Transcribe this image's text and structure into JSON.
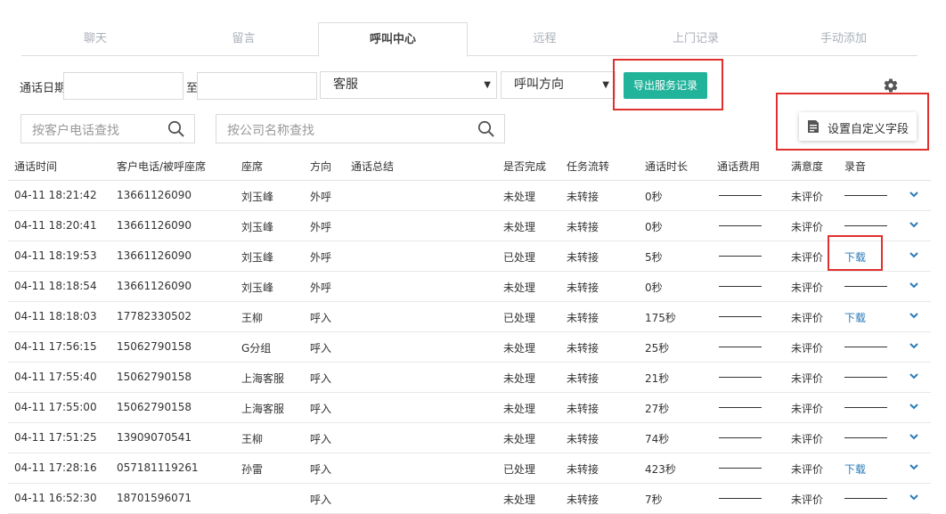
{
  "tabs": [
    {
      "label": "聊天"
    },
    {
      "label": "留言"
    },
    {
      "label": "呼叫中心",
      "active": true
    },
    {
      "label": "远程"
    },
    {
      "label": "上门记录"
    },
    {
      "label": "手动添加"
    }
  ],
  "filters": {
    "date_label": "通话日期",
    "to_label": "至",
    "agent_select": "客服",
    "direction_select": "呼叫方向",
    "export_label": "导出服务记录",
    "custom_field_label": "设置自定义字段",
    "customer_phone_placeholder": "按客户电话查找",
    "company_name_placeholder": "按公司名称查找"
  },
  "table": {
    "headers": [
      "通话时间",
      "客户电话/被呼座席",
      "座席",
      "方向",
      "通话总结",
      "是否完成",
      "任务流转",
      "通话时长",
      "通话费用",
      "满意度",
      "录音"
    ],
    "rows": [
      {
        "time": "04-11 18:21:42",
        "phone": "13661126090",
        "agent": "刘玉峰",
        "direction": "外呼",
        "summary": "",
        "done": "未处理",
        "transfer": "未转接",
        "duration": "0秒",
        "rating": "未评价",
        "recording": ""
      },
      {
        "time": "04-11 18:20:41",
        "phone": "13661126090",
        "agent": "刘玉峰",
        "direction": "外呼",
        "summary": "",
        "done": "未处理",
        "transfer": "未转接",
        "duration": "0秒",
        "rating": "未评价",
        "recording": ""
      },
      {
        "time": "04-11 18:19:53",
        "phone": "13661126090",
        "agent": "刘玉峰",
        "direction": "外呼",
        "summary": "",
        "done": "已处理",
        "transfer": "未转接",
        "duration": "5秒",
        "rating": "未评价",
        "recording": "下载"
      },
      {
        "time": "04-11 18:18:54",
        "phone": "13661126090",
        "agent": "刘玉峰",
        "direction": "外呼",
        "summary": "",
        "done": "未处理",
        "transfer": "未转接",
        "duration": "0秒",
        "rating": "未评价",
        "recording": ""
      },
      {
        "time": "04-11 18:18:03",
        "phone": "17782330502",
        "agent": "王柳",
        "direction": "呼入",
        "summary": "",
        "done": "已处理",
        "transfer": "未转接",
        "duration": "175秒",
        "rating": "未评价",
        "recording": "下载"
      },
      {
        "time": "04-11 17:56:15",
        "phone": "15062790158",
        "agent": "G分组",
        "direction": "呼入",
        "summary": "",
        "done": "未处理",
        "transfer": "未转接",
        "duration": "25秒",
        "rating": "未评价",
        "recording": ""
      },
      {
        "time": "04-11 17:55:40",
        "phone": "15062790158",
        "agent": "上海客服",
        "direction": "呼入",
        "summary": "",
        "done": "未处理",
        "transfer": "未转接",
        "duration": "21秒",
        "rating": "未评价",
        "recording": ""
      },
      {
        "time": "04-11 17:55:00",
        "phone": "15062790158",
        "agent": "上海客服",
        "direction": "呼入",
        "summary": "",
        "done": "未处理",
        "transfer": "未转接",
        "duration": "27秒",
        "rating": "未评价",
        "recording": ""
      },
      {
        "time": "04-11 17:51:25",
        "phone": "13909070541",
        "agent": "王柳",
        "direction": "呼入",
        "summary": "",
        "done": "未处理",
        "transfer": "未转接",
        "duration": "74秒",
        "rating": "未评价",
        "recording": ""
      },
      {
        "time": "04-11 17:28:16",
        "phone": "057181119261",
        "agent": "孙雷",
        "direction": "呼入",
        "summary": "",
        "done": "已处理",
        "transfer": "未转接",
        "duration": "423秒",
        "rating": "未评价",
        "recording": "下载"
      },
      {
        "time": "04-11 16:52:30",
        "phone": "18701596071",
        "agent": "",
        "direction": "呼入",
        "summary": "",
        "done": "未处理",
        "transfer": "未转接",
        "duration": "7秒",
        "rating": "未评价",
        "recording": ""
      }
    ]
  },
  "colors": {
    "accent": "#22b39b",
    "highlight": "#e0302d",
    "link": "#2a7ab8"
  }
}
